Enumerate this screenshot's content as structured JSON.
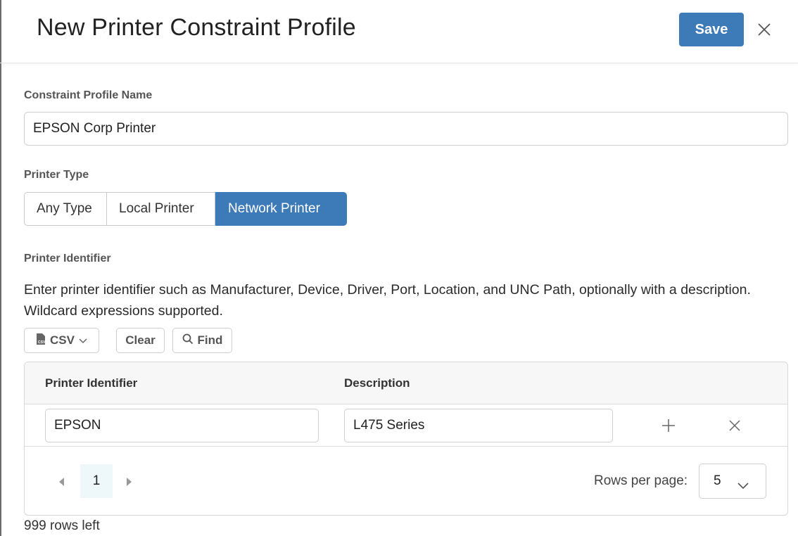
{
  "header": {
    "title": "New Printer Constraint Profile",
    "save_label": "Save",
    "close_icon": "close-icon"
  },
  "profile_name": {
    "label": "Constraint Profile Name",
    "value": "EPSON Corp Printer"
  },
  "printer_type": {
    "label": "Printer Type",
    "options": [
      "Any Type",
      "Local Printer",
      "Network Printer"
    ],
    "selected": "Network Printer"
  },
  "identifier": {
    "label": "Printer Identifier",
    "help": "Enter printer identifier such as Manufacturer, Device, Driver, Port, Location, and UNC Path, optionally with a description. Wildcard expressions supported."
  },
  "toolbar": {
    "csv_label": "CSV",
    "clear_label": "Clear",
    "find_label": "Find"
  },
  "table": {
    "columns": [
      "Printer Identifier",
      "Description"
    ],
    "rows": [
      {
        "identifier": "EPSON",
        "description": "L475 Series"
      }
    ]
  },
  "pagination": {
    "current_page": "1",
    "rows_per_page_label": "Rows per page:",
    "rows_per_page": "5"
  },
  "footer": {
    "rows_left": "999 rows left"
  },
  "colors": {
    "accent": "#3d7ab8",
    "active_page_bg": "#eef8fb"
  }
}
